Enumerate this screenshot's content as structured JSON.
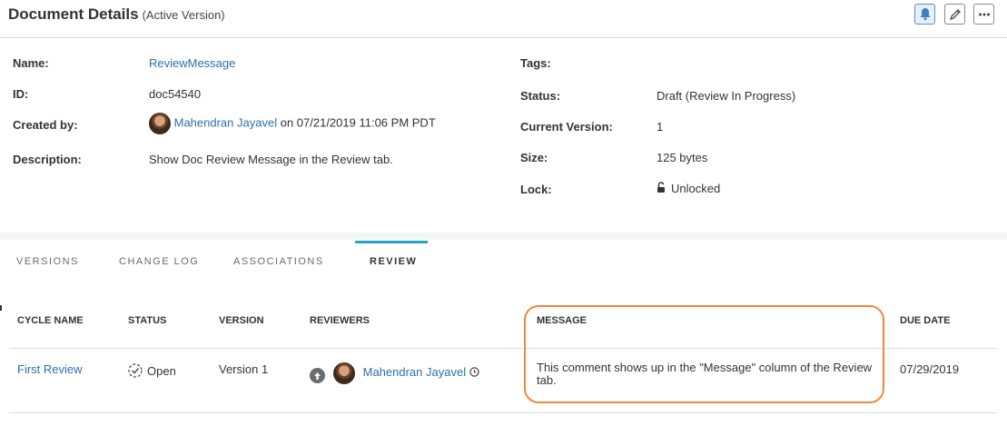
{
  "header": {
    "title": "Document Details",
    "subtitle": "(Active Version)",
    "buttons": {
      "notify_icon": "bell-icon",
      "edit_icon": "pencil-icon",
      "more_icon": "more-icon"
    }
  },
  "properties": {
    "left": {
      "name_label": "Name:",
      "name_value": "ReviewMessage",
      "id_label": "ID:",
      "id_value": "doc54540",
      "created_by_label": "Created by:",
      "created_by_user": "Mahendran Jayavel",
      "created_by_suffix": "on 07/21/2019 11:06 PM PDT",
      "description_label": "Description:",
      "description_value": "Show Doc Review Message in the Review tab."
    },
    "right": {
      "tags_label": "Tags:",
      "tags_value": "",
      "status_label": "Status:",
      "status_value": "Draft (Review In Progress)",
      "current_version_label": "Current Version:",
      "current_version_value": "1",
      "size_label": "Size:",
      "size_value": "125 bytes",
      "lock_label": "Lock:",
      "lock_value": "Unlocked",
      "lock_icon": "unlock-icon"
    }
  },
  "tabs": [
    {
      "label": "VERSIONS",
      "active": false
    },
    {
      "label": "CHANGE LOG",
      "active": false
    },
    {
      "label": "ASSOCIATIONS",
      "active": false
    },
    {
      "label": "REVIEW",
      "active": true
    }
  ],
  "review_table": {
    "columns": [
      "CYCLE NAME",
      "STATUS",
      "VERSION",
      "REVIEWERS",
      "MESSAGE",
      "DUE DATE"
    ],
    "rows": [
      {
        "cycle_name": "First Review",
        "status": "Open",
        "version": "Version 1",
        "reviewer": "Mahendran Jayavel",
        "message": "This comment shows up in the \"Message\" column of the Review tab.",
        "due_date": "07/29/2019"
      }
    ]
  },
  "colors": {
    "link": "#2f6fa8",
    "tab_indicator": "#2ba3c7",
    "highlight": "#ee8a3c"
  }
}
